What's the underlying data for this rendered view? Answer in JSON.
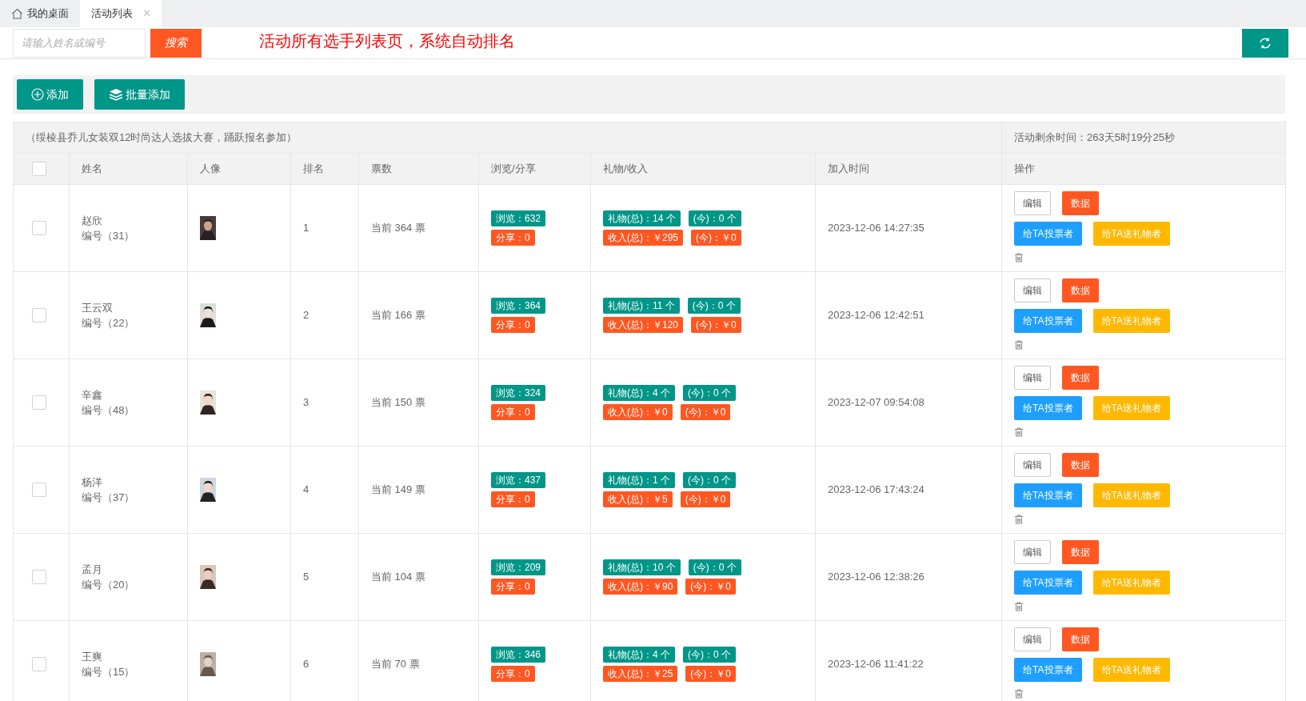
{
  "tabs": [
    {
      "label": "我的桌面",
      "selected": false,
      "kind": "home"
    },
    {
      "label": "活动列表",
      "selected": true,
      "kind": "page",
      "close": "×"
    }
  ],
  "search": {
    "placeholder": "请输入姓名或编号",
    "button": "搜索"
  },
  "notice": "活动所有选手列表页，系统自动排名",
  "actions": [
    {
      "label": "添加",
      "kind": "add"
    },
    {
      "label": "批量添加",
      "kind": "batch"
    }
  ],
  "table": {
    "caption": "（绥棱县乔儿女装双12时尚达人选拔大赛，踊跃报名参加）",
    "remaining": "活动剩余时间：263天5时19分25秒",
    "select_all": false,
    "columns": [
      "姓名",
      "人像",
      "排名",
      "票数",
      "浏览/分享",
      "礼物/收入",
      "加入时间",
      "操作"
    ],
    "rows": [
      {
        "checked": false,
        "name": "赵欣",
        "number": "编号（31）",
        "rank": "1",
        "votes": "当前 364 票",
        "views": "浏览：632",
        "shares": "分享：0",
        "gifts_total": "礼物(总)：14 个",
        "gifts_today": "(今)：0 个",
        "income_total": "收入(总)：￥295",
        "income_today": "(今)：￥0",
        "joined": "2023-12-06 14:27:35",
        "buttons": [
          {
            "label": "编辑",
            "kind": "plain"
          },
          {
            "label": "数据",
            "kind": "danger"
          },
          {
            "label": "给TA投票者",
            "kind": "info"
          },
          {
            "label": "给TA送礼物者",
            "kind": "warn"
          }
        ]
      },
      {
        "checked": false,
        "name": "王云双",
        "number": "编号（22）",
        "rank": "2",
        "votes": "当前 166 票",
        "views": "浏览：364",
        "shares": "分享：0",
        "gifts_total": "礼物(总)：11 个",
        "gifts_today": "(今)：0 个",
        "income_total": "收入(总)：￥120",
        "income_today": "(今)：￥0",
        "joined": "2023-12-06 12:42:51",
        "buttons": [
          {
            "label": "编辑",
            "kind": "plain"
          },
          {
            "label": "数据",
            "kind": "danger"
          },
          {
            "label": "给TA投票者",
            "kind": "info"
          },
          {
            "label": "给TA送礼物者",
            "kind": "warn"
          }
        ]
      },
      {
        "checked": false,
        "name": "辛鑫",
        "number": "编号（48）",
        "rank": "3",
        "votes": "当前 150 票",
        "views": "浏览：324",
        "shares": "分享：0",
        "gifts_total": "礼物(总)：4 个",
        "gifts_today": "(今)：0 个",
        "income_total": "收入(总)：￥0",
        "income_today": "(今)：￥0",
        "joined": "2023-12-07 09:54:08",
        "buttons": [
          {
            "label": "编辑",
            "kind": "plain"
          },
          {
            "label": "数据",
            "kind": "danger"
          },
          {
            "label": "给TA投票者",
            "kind": "info"
          },
          {
            "label": "给TA送礼物者",
            "kind": "warn"
          }
        ]
      },
      {
        "checked": false,
        "name": "杨洋",
        "number": "编号（37）",
        "rank": "4",
        "votes": "当前 149 票",
        "views": "浏览：437",
        "shares": "分享：0",
        "gifts_total": "礼物(总)：1 个",
        "gifts_today": "(今)：0 个",
        "income_total": "收入(总)：￥5",
        "income_today": "(今)：￥0",
        "joined": "2023-12-06 17:43:24",
        "buttons": [
          {
            "label": "编辑",
            "kind": "plain"
          },
          {
            "label": "数据",
            "kind": "danger"
          },
          {
            "label": "给TA投票者",
            "kind": "info"
          },
          {
            "label": "给TA送礼物者",
            "kind": "warn"
          }
        ]
      },
      {
        "checked": false,
        "name": "孟月",
        "number": "编号（20）",
        "rank": "5",
        "votes": "当前 104 票",
        "views": "浏览：209",
        "shares": "分享：0",
        "gifts_total": "礼物(总)：10 个",
        "gifts_today": "(今)：0 个",
        "income_total": "收入(总)：￥90",
        "income_today": "(今)：￥0",
        "joined": "2023-12-06 12:38:26",
        "buttons": [
          {
            "label": "编辑",
            "kind": "plain"
          },
          {
            "label": "数据",
            "kind": "danger"
          },
          {
            "label": "给TA投票者",
            "kind": "info"
          },
          {
            "label": "给TA送礼物者",
            "kind": "warn"
          }
        ]
      },
      {
        "checked": false,
        "name": "王爽",
        "number": "编号（15）",
        "rank": "6",
        "votes": "当前 70 票",
        "views": "浏览：346",
        "shares": "分享：0",
        "gifts_total": "礼物(总)：4 个",
        "gifts_today": "(今)：0 个",
        "income_total": "收入(总)：￥25",
        "income_today": "(今)：￥0",
        "joined": "2023-12-06 11:41:22",
        "buttons": [
          {
            "label": "编辑",
            "kind": "plain"
          },
          {
            "label": "数据",
            "kind": "danger"
          },
          {
            "label": "给TA投票者",
            "kind": "info"
          },
          {
            "label": "给TA送礼物者",
            "kind": "warn"
          }
        ]
      }
    ]
  }
}
